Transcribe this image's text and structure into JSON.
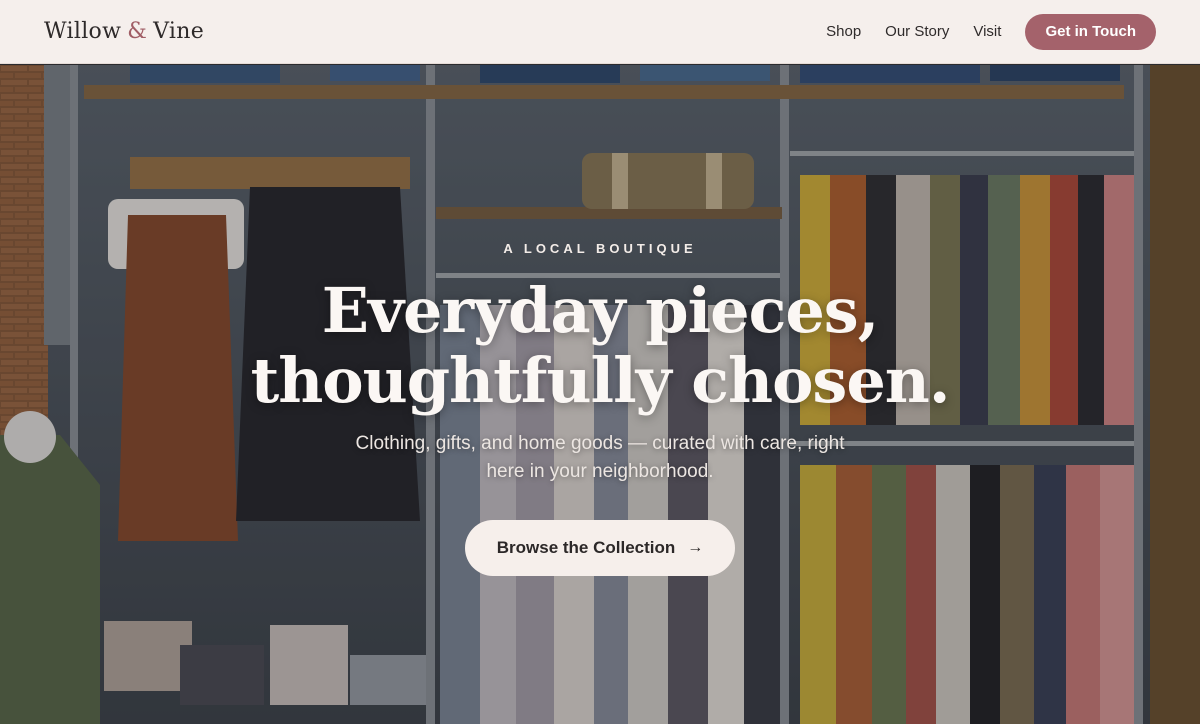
{
  "brand": {
    "name_part1": "Willow",
    "ampersand": "&",
    "name_part2": "Vine"
  },
  "nav": {
    "items": [
      "Shop",
      "Our Story",
      "Visit"
    ],
    "cta": "Get in Touch"
  },
  "hero": {
    "eyebrow": "A LOCAL BOUTIQUE",
    "headline_line1": "Everyday pieces,",
    "headline_line2": "thoughtfully chosen.",
    "subtext": "Clothing, gifts, and home goods — curated with care, right here in your neighborhood.",
    "button_label": "Browse the Collection",
    "button_icon": "arrow-right-icon"
  },
  "colors": {
    "accent": "#a4626b",
    "header_bg": "#f5efec",
    "button_light": "#f6efeb"
  }
}
